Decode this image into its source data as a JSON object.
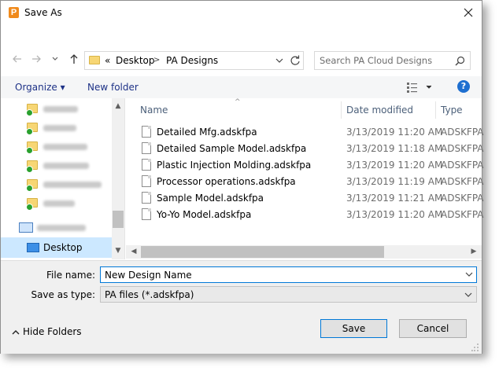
{
  "window": {
    "title": "Save As",
    "app_icon_letter": "P"
  },
  "address_bar": {
    "overflow_marker": "«",
    "crumbs": [
      "Desktop",
      "PA Designs"
    ],
    "separator": ">"
  },
  "search": {
    "placeholder": "Search PA Cloud Designs"
  },
  "toolbar": {
    "organize_label": "Organize ▾",
    "new_folder_label": "New folder",
    "help_label": "?"
  },
  "nav_pane": {
    "items_obscured": 6,
    "selected_item": "Desktop"
  },
  "file_list": {
    "columns": [
      "Name",
      "Date modified",
      "Type"
    ],
    "files": [
      {
        "name": "Detailed Mfg.adskfpa",
        "date": "3/13/2019 11:20 AM",
        "type": "ADSKFPA"
      },
      {
        "name": "Detailed Sample Model.adskfpa",
        "date": "3/13/2019 11:18 AM",
        "type": "ADSKFPA"
      },
      {
        "name": "Plastic Injection Molding.adskfpa",
        "date": "3/13/2019 11:20 AM",
        "type": "ADSKFPA"
      },
      {
        "name": "Processor operations.adskfpa",
        "date": "3/13/2019 11:19 AM",
        "type": "ADSKFPA"
      },
      {
        "name": "Sample Model.adskfpa",
        "date": "3/13/2019 11:21 AM",
        "type": "ADSKFPA"
      },
      {
        "name": "Yo-Yo Model.adskfpa",
        "date": "3/13/2019 11:20 AM",
        "type": "ADSKFPA"
      }
    ]
  },
  "form": {
    "file_name_label": "File name:",
    "file_name_value": "New Design Name",
    "save_type_label": "Save as type:",
    "save_type_value": "PA files (*.adskfpa)",
    "hide_folders_label": "Hide Folders",
    "save_button": "Save",
    "cancel_button": "Cancel"
  },
  "colors": {
    "accent": "#0078d7",
    "selection": "#cce8ff",
    "link": "#1e3287",
    "folder": "#f7d674",
    "sync_check": "#2aa12e"
  }
}
